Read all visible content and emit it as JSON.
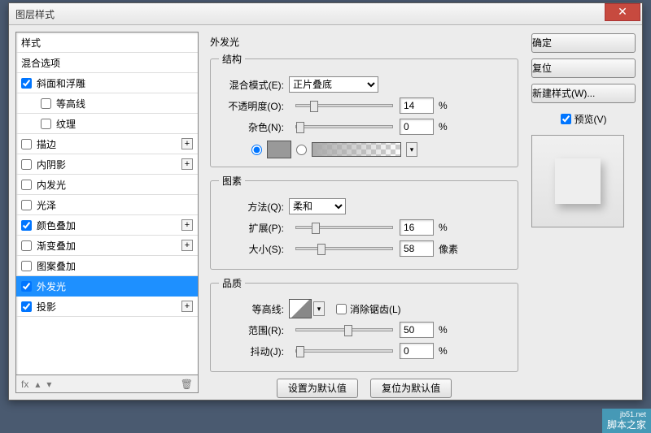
{
  "title": "图层样式",
  "left": {
    "header1": "样式",
    "header2": "混合选项",
    "items": [
      {
        "label": "斜面和浮雕",
        "checked": true,
        "add": false
      },
      {
        "label": "等高线",
        "checked": false,
        "indent": true,
        "add": false
      },
      {
        "label": "纹理",
        "checked": false,
        "indent": true,
        "add": false
      },
      {
        "label": "描边",
        "checked": false,
        "add": true
      },
      {
        "label": "内阴影",
        "checked": false,
        "add": true
      },
      {
        "label": "内发光",
        "checked": false,
        "add": false
      },
      {
        "label": "光泽",
        "checked": false,
        "add": false
      },
      {
        "label": "颜色叠加",
        "checked": true,
        "add": true
      },
      {
        "label": "渐变叠加",
        "checked": false,
        "add": true
      },
      {
        "label": "图案叠加",
        "checked": false,
        "add": false
      },
      {
        "label": "外发光",
        "checked": true,
        "add": false,
        "selected": true
      },
      {
        "label": "投影",
        "checked": true,
        "add": true
      }
    ],
    "footer_fx": "fx"
  },
  "center": {
    "panel_title": "外发光",
    "group_structure": "结构",
    "blend_mode_label": "混合模式(E):",
    "blend_mode_value": "正片叠底",
    "opacity_label": "不透明度(O):",
    "opacity_value": "14",
    "noise_label": "杂色(N):",
    "noise_value": "0",
    "percent": "%",
    "group_element": "图素",
    "technique_label": "方法(Q):",
    "technique_value": "柔和",
    "spread_label": "扩展(P):",
    "spread_value": "16",
    "size_label": "大小(S):",
    "size_value": "58",
    "pixels": "像素",
    "group_quality": "品质",
    "contour_label": "等高线:",
    "antialias_label": "消除锯齿(L)",
    "range_label": "范围(R):",
    "range_value": "50",
    "jitter_label": "抖动(J):",
    "jitter_value": "0",
    "default_btn": "设置为默认值",
    "reset_btn": "复位为默认值"
  },
  "right": {
    "ok": "确定",
    "cancel": "复位",
    "new_style": "新建样式(W)...",
    "preview_label": "预览(V)"
  },
  "watermark": {
    "url": "jb51.net",
    "text": "脚本之家"
  }
}
